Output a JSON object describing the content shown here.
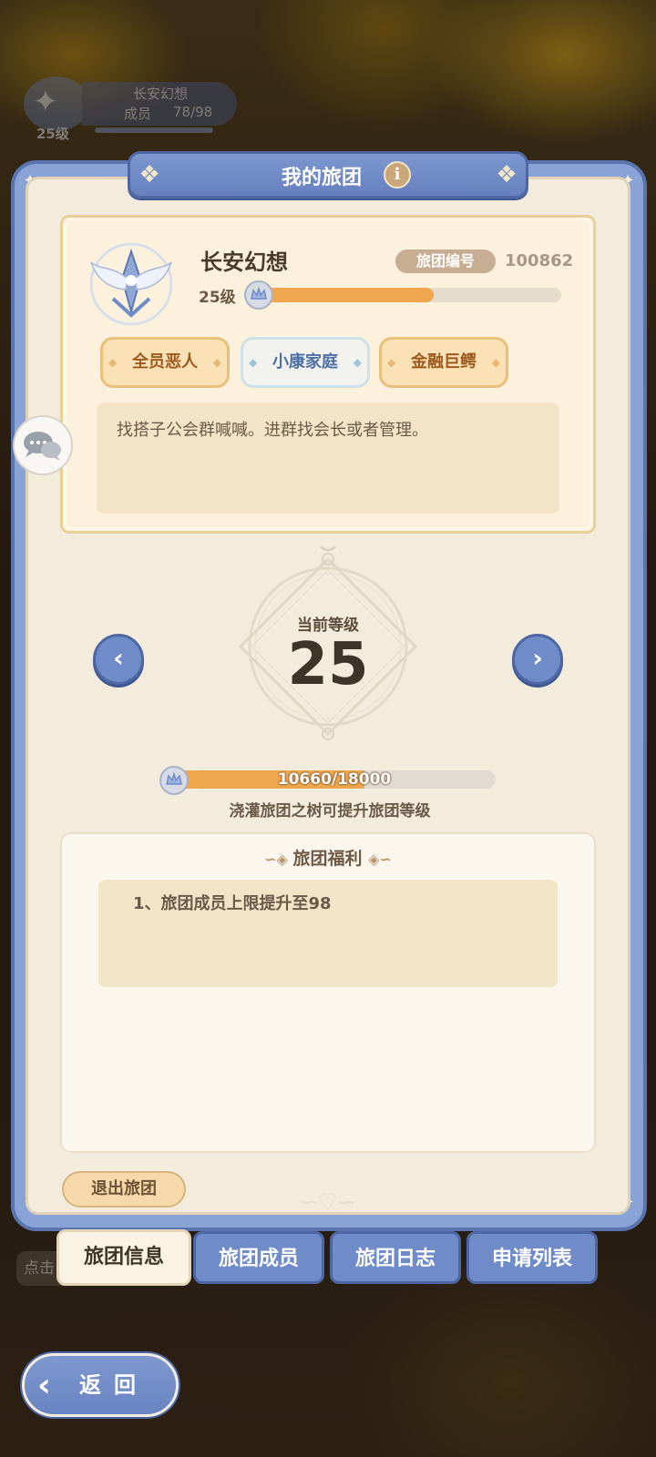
{
  "background": {
    "mini_guild": {
      "level": "25级",
      "name": "长安幻想",
      "members_label": "成员",
      "members_count": "78/98"
    },
    "hint_text": "点击"
  },
  "panel": {
    "title": "我的旅团",
    "info_icon": "i"
  },
  "guild": {
    "name": "长安幻想",
    "level_text": "25级",
    "exp_progress": 0.57,
    "id_label": "旅团编号",
    "id_value": "100862",
    "tags": [
      "全员恶人",
      "小康家庭",
      "金融巨鳄"
    ],
    "description": "找搭子公会群喊喊。进群找会长或者管理。"
  },
  "level": {
    "label": "当前等级",
    "value": "25",
    "prev_icon": "chevron-left-icon",
    "next_icon": "chevron-right-icon"
  },
  "tree": {
    "exp_text": "10660/18000",
    "exp_current": 10660,
    "exp_max": 18000,
    "hint": "浇灌旅团之树可提升旅团等级"
  },
  "benefits": {
    "title": "旅团福利",
    "items": [
      "1、旅团成员上限提升至98"
    ]
  },
  "actions": {
    "quit": "退出旅团",
    "back": "返回"
  },
  "tabs": [
    {
      "label": "旅团信息",
      "active": true
    },
    {
      "label": "旅团成员",
      "active": false
    },
    {
      "label": "旅团日志",
      "active": false
    },
    {
      "label": "申请列表",
      "active": false
    }
  ],
  "colors": {
    "accent_blue": "#6f8bc8",
    "panel_cream": "#f3ecdd",
    "progress_orange": "#f0a64c",
    "tag_blue_text": "#4f6fa7",
    "tag_orange_text": "#9e5a1e"
  }
}
